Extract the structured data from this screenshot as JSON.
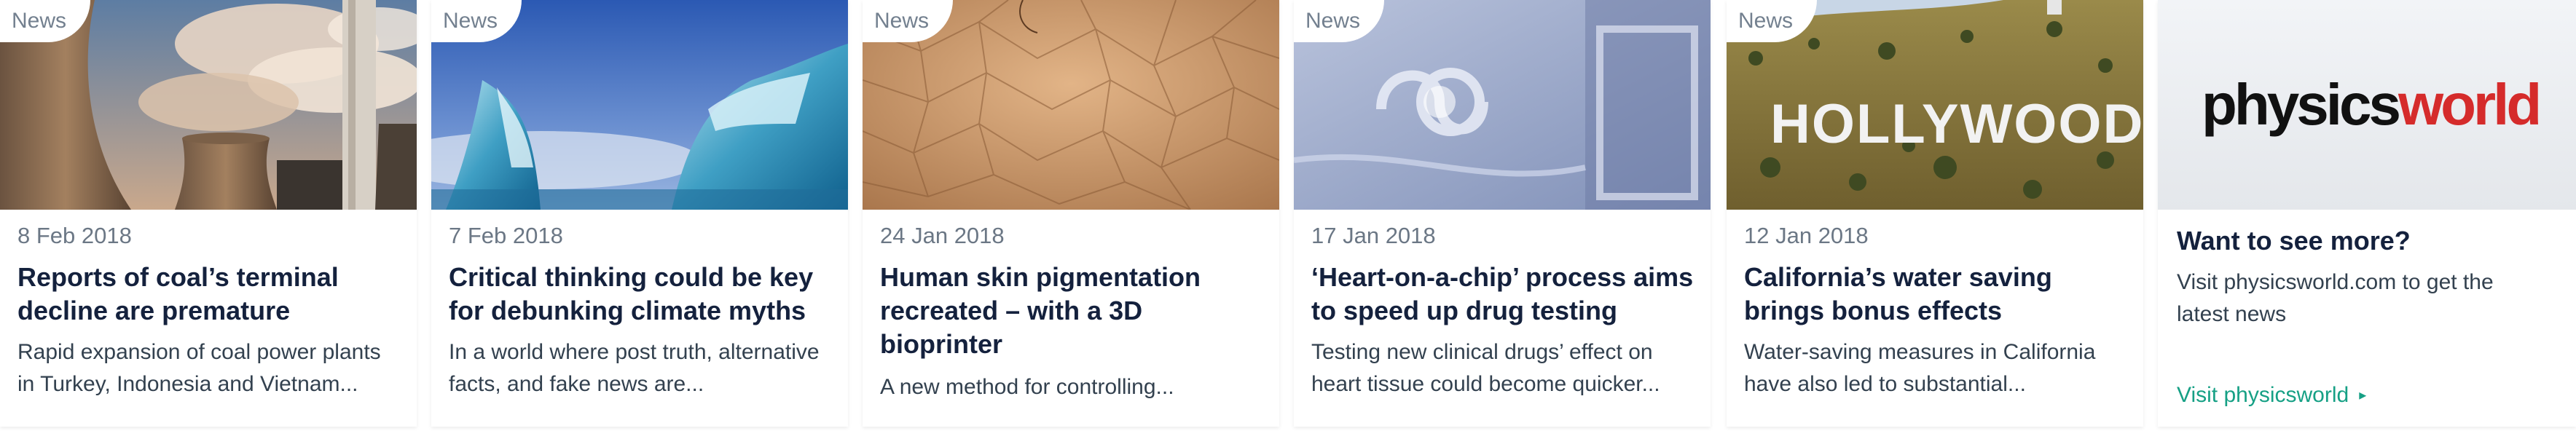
{
  "cards": [
    {
      "tag": "News",
      "date": "8 Feb 2018",
      "title": "Reports of coal’s terminal decline are premature",
      "excerpt": "Rapid expansion of coal power plants in Turkey, Indonesia and Vietnam..."
    },
    {
      "tag": "News",
      "date": "7 Feb 2018",
      "title": "Critical thinking could be key for debunking climate myths",
      "excerpt": "In a world where post truth, alternative facts, and fake news are..."
    },
    {
      "tag": "News",
      "date": "24 Jan 2018",
      "title": "Human skin pigmentation recreated – with a 3D bioprinter",
      "excerpt": "A new method for controlling..."
    },
    {
      "tag": "News",
      "date": "17 Jan 2018",
      "title": "‘Heart-on-a-chip’ process aims to speed up drug testing",
      "excerpt": "Testing new clinical drugs’ effect on heart tissue could become quicker..."
    },
    {
      "tag": "News",
      "date": "12 Jan 2018",
      "title": "California’s water saving brings bonus effects",
      "excerpt": "Water-saving measures in California have also led to substantial...",
      "image_sign_text": "HOLLYWOOD"
    }
  ],
  "promo": {
    "logo_part1": "physics",
    "logo_part2": "world",
    "title": "Want to see more?",
    "text": "Visit physicsworld.com to get the latest news",
    "link_label": "Visit physicsworld",
    "link_arrow": "▸"
  },
  "colors": {
    "title": "#14213d",
    "date": "#6b7785",
    "excerpt": "#33414f",
    "link": "#16a085",
    "logo_red": "#d52b2b"
  }
}
